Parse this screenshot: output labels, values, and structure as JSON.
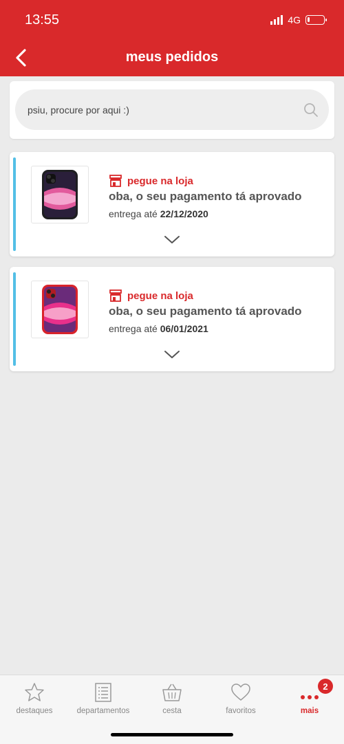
{
  "status_bar": {
    "time": "13:55",
    "network": "4G",
    "battery_level": 0.15
  },
  "header": {
    "title": "meus pedidos"
  },
  "search": {
    "placeholder": "psiu, procure por aqui :)"
  },
  "orders": [
    {
      "store_label": "pegue na loja",
      "status": "oba, o seu pagamento tá aprovado",
      "delivery_prefix": "entrega até",
      "delivery_date": "22/12/2020",
      "product_color": "#1f1f22",
      "accent_color": "#53bfe6"
    },
    {
      "store_label": "pegue na loja",
      "status": "oba, o seu pagamento tá aprovado",
      "delivery_prefix": "entrega até",
      "delivery_date": "06/01/2021",
      "product_color": "#d9232b",
      "accent_color": "#53bfe6"
    }
  ],
  "nav": {
    "items": [
      {
        "label": "destaques",
        "icon": "star-icon"
      },
      {
        "label": "departamentos",
        "icon": "list-icon"
      },
      {
        "label": "cesta",
        "icon": "basket-icon"
      },
      {
        "label": "favoritos",
        "icon": "heart-icon"
      },
      {
        "label": "mais",
        "icon": "more-icon"
      }
    ],
    "badge": "2"
  },
  "colors": {
    "brand_red": "#d9292b",
    "accent_blue": "#53bfe6"
  }
}
